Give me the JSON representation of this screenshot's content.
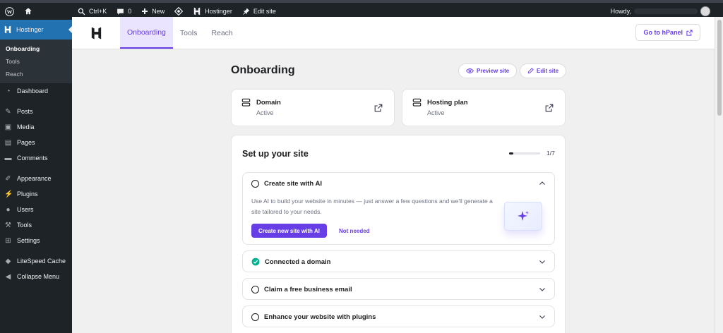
{
  "admin_bar": {
    "search_label": "Ctrl+K",
    "comments_count": "0",
    "new_label": "New",
    "site_label": "Hostinger",
    "edit_label": "Edit site",
    "howdy": "Howdy,"
  },
  "sidebar": {
    "plugin_label": "Hostinger",
    "submenu": [
      "Onboarding",
      "Tools",
      "Reach"
    ],
    "items": {
      "dashboard": "Dashboard",
      "posts": "Posts",
      "media": "Media",
      "pages": "Pages",
      "comments": "Comments",
      "appearance": "Appearance",
      "plugins": "Plugins",
      "users": "Users",
      "tools": "Tools",
      "settings": "Settings",
      "litespeed": "LiteSpeed Cache",
      "collapse": "Collapse Menu"
    }
  },
  "header": {
    "tabs": [
      "Onboarding",
      "Tools",
      "Reach"
    ],
    "hpanel_label": "Go to hPanel"
  },
  "main": {
    "title": "Onboarding",
    "preview_label": "Preview site",
    "edit_label": "Edit site",
    "resources": [
      {
        "title": "Domain",
        "status": "Active"
      },
      {
        "title": "Hosting plan",
        "status": "Active"
      }
    ],
    "setup": {
      "title": "Set up your site",
      "progress_text": "1/7",
      "progress_fraction": 0.14,
      "tasks": [
        {
          "label": "Create site with AI",
          "description": "Use AI to build your website in minutes — just answer a few questions and we'll generate a site tailored to your needs.",
          "primary_label": "Create new site with AI",
          "secondary_label": "Not needed"
        },
        {
          "label": "Connected a domain"
        },
        {
          "label": "Claim a free business email"
        },
        {
          "label": "Enhance your website with plugins"
        }
      ]
    }
  },
  "colors": {
    "accent": "#673de6",
    "success": "#00b090",
    "admin_bg": "#1d2327",
    "admin_active": "#2271b1"
  }
}
